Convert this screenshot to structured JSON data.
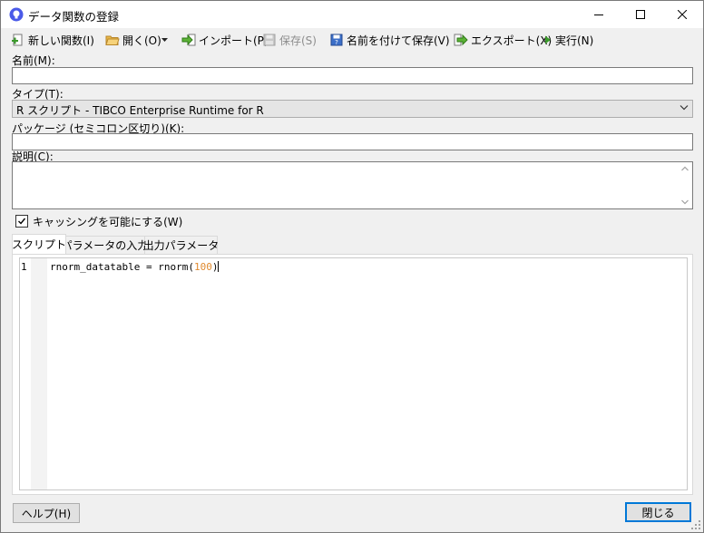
{
  "window": {
    "title": "データ関数の登録"
  },
  "toolbar": {
    "new_label": "新しい関数(I)",
    "open_label": "開く(O)",
    "import_label": "インポート(P)",
    "save_label": "保存(S)",
    "save_as_label": "名前を付けて保存(V)",
    "export_label": "エクスポート(X)",
    "run_label": "実行(N)"
  },
  "form": {
    "name_label": "名前(M):",
    "name_value": "",
    "type_label": "タイプ(T):",
    "type_value": "R スクリプト - TIBCO Enterprise Runtime for R",
    "packages_label": "パッケージ (セミコロン区切り)(K):",
    "packages_value": "",
    "description_label": "説明(C):",
    "description_value": "",
    "caching_label": "キャッシングを可能にする(W)",
    "caching_checked": true
  },
  "tabs": [
    {
      "label": "スクリプト",
      "active": true
    },
    {
      "label": "パラメータの入力",
      "active": false
    },
    {
      "label": "出力パラメータ",
      "active": false
    }
  ],
  "editor": {
    "line_number": "1",
    "code_prefix": "rnorm_datatable = rnorm(",
    "code_number": "100",
    "code_suffix": ")"
  },
  "footer": {
    "help_label": "ヘルプ(H)",
    "close_label": "閉じる"
  },
  "colors": {
    "accent": "#0078d7",
    "number_literal": "#e08a2e",
    "app_icon": "#4a5ae8"
  }
}
